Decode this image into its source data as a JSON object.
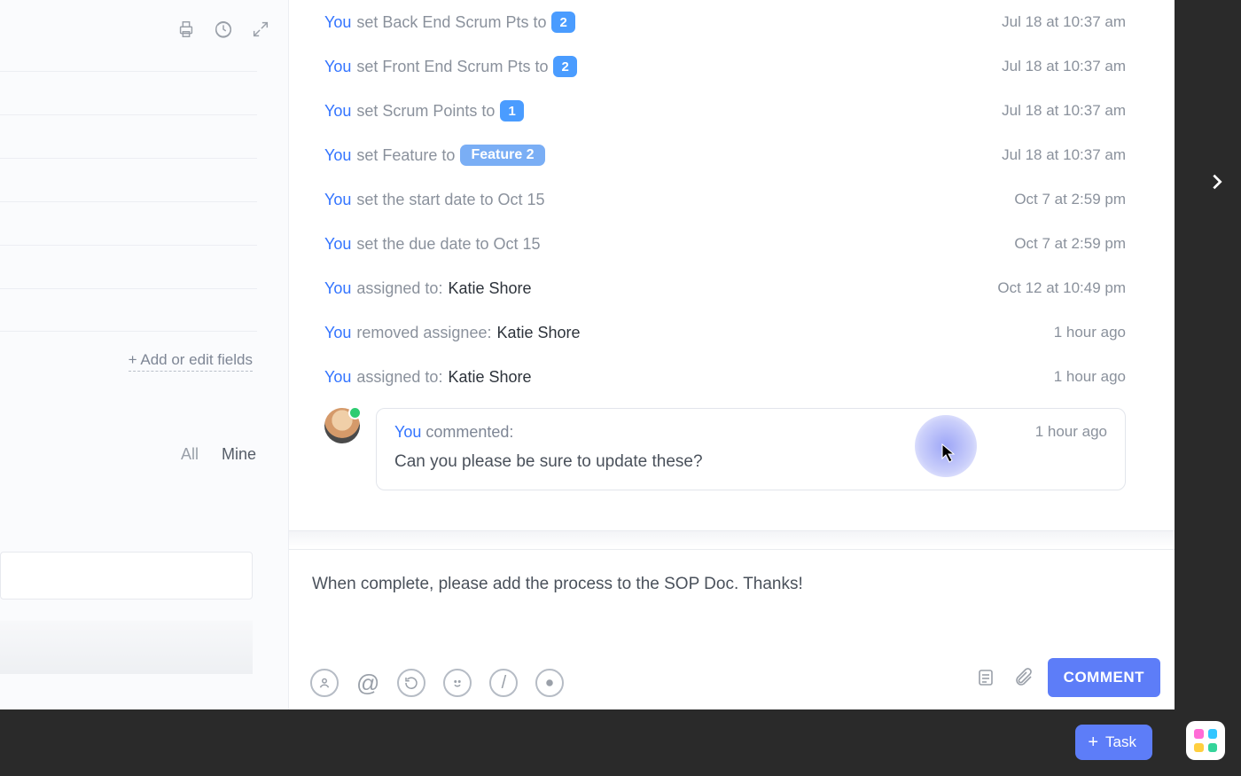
{
  "leftPane": {
    "addFieldsLabel": "+ Add or edit fields",
    "filters": {
      "all": "All",
      "mine": "Mine"
    }
  },
  "activity": {
    "actor": "You",
    "rows": [
      {
        "verb": "set Back End Scrum Pts to",
        "pill": "2",
        "pillKind": "num",
        "time": "Jul 18 at 10:37 am"
      },
      {
        "verb": "set Front End Scrum Pts to",
        "pill": "2",
        "pillKind": "num",
        "time": "Jul 18 at 10:37 am"
      },
      {
        "verb": "set Scrum Points to",
        "pill": "1",
        "pillKind": "num",
        "time": "Jul 18 at 10:37 am"
      },
      {
        "verb": "set Feature to",
        "pill": "Feature 2",
        "pillKind": "feature",
        "time": "Jul 18 at 10:37 am"
      },
      {
        "verb": "set the start date to Oct 15",
        "time": "Oct 7 at 2:59 pm"
      },
      {
        "verb": "set the due date to Oct 15",
        "time": "Oct 7 at 2:59 pm"
      },
      {
        "verb": "assigned to:",
        "person": "Katie Shore",
        "time": "Oct 12 at 10:49 pm"
      },
      {
        "verb": "removed assignee:",
        "person": "Katie Shore",
        "time": "1 hour ago"
      },
      {
        "verb": "assigned to:",
        "person": "Katie Shore",
        "time": "1 hour ago"
      }
    ],
    "comment": {
      "actor": "You",
      "verb": "commented:",
      "time": "1 hour ago",
      "body": "Can you please be sure to update these?"
    }
  },
  "composer": {
    "draft": "When complete, please add the process to the SOP Doc. Thanks!",
    "submitLabel": "COMMENT"
  },
  "bottomBar": {
    "newTaskLabel": "Task"
  }
}
